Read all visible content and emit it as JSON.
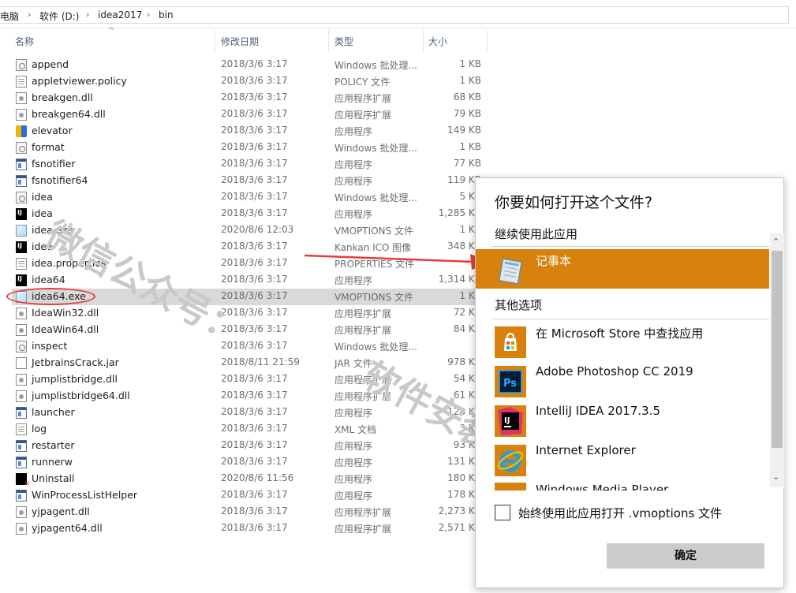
{
  "breadcrumb": {
    "items": [
      "电脑",
      "软件 (D:)",
      "idea2017",
      "bin"
    ],
    "separator": "›"
  },
  "columns": {
    "name": "名称",
    "date": "修改日期",
    "type": "类型",
    "size": "大小"
  },
  "files": [
    {
      "name": "append",
      "date": "2018/3/6 3:17",
      "type": "Windows 批处理...",
      "size": "1 KB",
      "icon": "bat"
    },
    {
      "name": "appletviewer.policy",
      "date": "2018/3/6 3:17",
      "type": "POLICY 文件",
      "size": "1 KB",
      "icon": "txt"
    },
    {
      "name": "breakgen.dll",
      "date": "2018/3/6 3:17",
      "type": "应用程序扩展",
      "size": "68 KB",
      "icon": "dll"
    },
    {
      "name": "breakgen64.dll",
      "date": "2018/3/6 3:17",
      "type": "应用程序扩展",
      "size": "79 KB",
      "icon": "dll"
    },
    {
      "name": "elevator",
      "date": "2018/3/6 3:17",
      "type": "应用程序",
      "size": "149 KB",
      "icon": "elev"
    },
    {
      "name": "format",
      "date": "2018/3/6 3:17",
      "type": "Windows 批处理...",
      "size": "1 KB",
      "icon": "bat"
    },
    {
      "name": "fsnotifier",
      "date": "2018/3/6 3:17",
      "type": "应用程序",
      "size": "77 KB",
      "icon": "app"
    },
    {
      "name": "fsnotifier64",
      "date": "2018/3/6 3:17",
      "type": "应用程序",
      "size": "119 KB",
      "icon": "app"
    },
    {
      "name": "idea",
      "date": "2018/3/6 3:17",
      "type": "Windows 批处理...",
      "size": "5 KB",
      "icon": "bat"
    },
    {
      "name": "idea",
      "date": "2018/3/6 3:17",
      "type": "应用程序",
      "size": "1,285 KB",
      "icon": "ij"
    },
    {
      "name": "idea.exe",
      "date": "2020/8/6 12:03",
      "type": "VMOPTIONS 文件",
      "size": "1 KB",
      "icon": "vm"
    },
    {
      "name": "idea",
      "date": "2018/3/6 3:17",
      "type": "Kankan ICO 图像",
      "size": "348 KB",
      "icon": "ij"
    },
    {
      "name": "idea.properties",
      "date": "2018/3/6 3:17",
      "type": "PROPERTIES 文件",
      "size": "",
      "icon": "txt"
    },
    {
      "name": "idea64",
      "date": "2018/3/6 3:17",
      "type": "应用程序",
      "size": "1,314 KB",
      "icon": "ij"
    },
    {
      "name": "idea64.exe",
      "date": "2018/3/6 3:17",
      "type": "VMOPTIONS 文件",
      "size": "1 KB",
      "icon": "vm",
      "selected": true
    },
    {
      "name": "IdeaWin32.dll",
      "date": "2018/3/6 3:17",
      "type": "应用程序扩展",
      "size": "72 KB",
      "icon": "dll"
    },
    {
      "name": "IdeaWin64.dll",
      "date": "2018/3/6 3:17",
      "type": "应用程序扩展",
      "size": "84 KB",
      "icon": "dll"
    },
    {
      "name": "inspect",
      "date": "2018/3/6 3:17",
      "type": "Windows 批处理...",
      "size": "",
      "icon": "bat"
    },
    {
      "name": "JetbrainsCrack.jar",
      "date": "2018/8/11 21:59",
      "type": "JAR 文件",
      "size": "978 KB",
      "icon": "jar"
    },
    {
      "name": "jumplistbridge.dll",
      "date": "2018/3/6 3:17",
      "type": "应用程序扩展",
      "size": "54 KB",
      "icon": "dll"
    },
    {
      "name": "jumplistbridge64.dll",
      "date": "2018/3/6 3:17",
      "type": "应用程序扩展",
      "size": "61 KB",
      "icon": "dll"
    },
    {
      "name": "launcher",
      "date": "2018/3/6 3:17",
      "type": "应用程序",
      "size": "123 KB",
      "icon": "app"
    },
    {
      "name": "log",
      "date": "2018/3/6 3:17",
      "type": "XML 文档",
      "size": "3 KB",
      "icon": "txt"
    },
    {
      "name": "restarter",
      "date": "2018/3/6 3:17",
      "type": "应用程序",
      "size": "93 KB",
      "icon": "app"
    },
    {
      "name": "runnerw",
      "date": "2018/3/6 3:17",
      "type": "应用程序",
      "size": "131 KB",
      "icon": "app"
    },
    {
      "name": "Uninstall",
      "date": "2020/8/6 11:56",
      "type": "应用程序",
      "size": "180 KB",
      "icon": "unins"
    },
    {
      "name": "WinProcessListHelper",
      "date": "2018/3/6 3:17",
      "type": "应用程序",
      "size": "178 KB",
      "icon": "app"
    },
    {
      "name": "yjpagent.dll",
      "date": "2018/3/6 3:17",
      "type": "应用程序扩展",
      "size": "2,273 KB",
      "icon": "dll"
    },
    {
      "name": "yjpagent64.dll",
      "date": "2018/3/6 3:17",
      "type": "应用程序扩展",
      "size": "2,571 KB",
      "icon": "dll"
    }
  ],
  "watermark": [
    "微信公众号：",
    "软件安装大神"
  ],
  "dialog": {
    "title": "你要如何打开这个文件?",
    "keep_using": "继续使用此应用",
    "other_options": "其他选项",
    "apps": [
      {
        "label": "记事本",
        "icon": "notepad-icon",
        "selected": true
      },
      {
        "label": "在 Microsoft Store 中查找应用",
        "icon": "store-icon"
      },
      {
        "label": "Adobe Photoshop CC 2019",
        "icon": "photoshop-icon"
      },
      {
        "label": "IntelliJ IDEA 2017.3.5",
        "icon": "intellij-icon"
      },
      {
        "label": "Internet Explorer",
        "icon": "ie-icon"
      },
      {
        "label": "Windows Media Player",
        "icon": "wmp-icon"
      }
    ],
    "always_use": "始终使用此应用打开 .vmoptions 文件",
    "ok": "确定"
  },
  "colors": {
    "selected_app": "#d6820c",
    "annotation": "#e83b3b",
    "row_selected": "#d9d9d9"
  }
}
